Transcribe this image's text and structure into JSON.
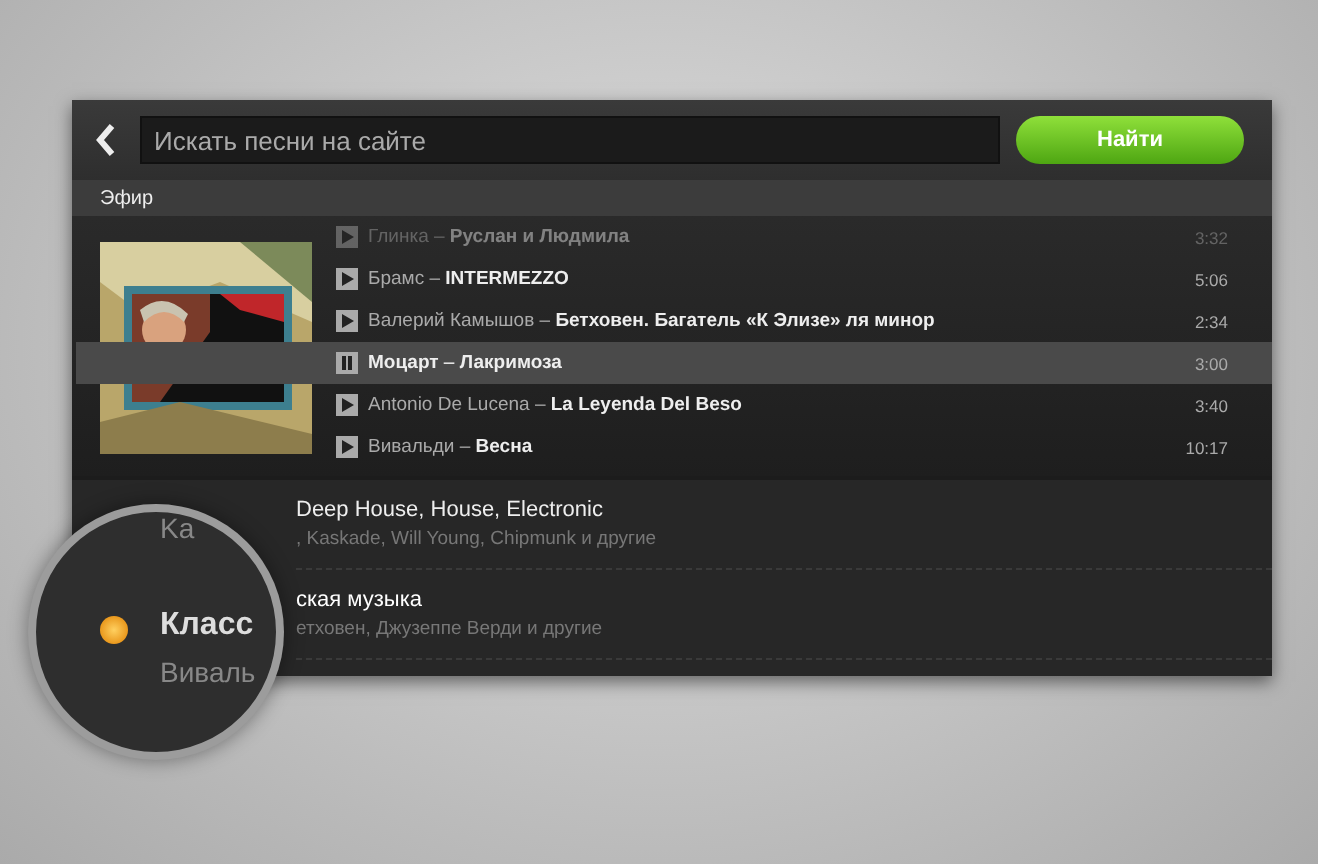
{
  "search": {
    "placeholder": "Искать песни на сайте",
    "button": "Найти"
  },
  "section": "Эфир",
  "tracks": [
    {
      "text": "Глинка – **Руслан и Людмила**",
      "time": "3:32",
      "playing": false,
      "faded": true
    },
    {
      "text": "Брамс – **INTERMEZZO**",
      "time": "5:06",
      "playing": false,
      "faded": false
    },
    {
      "text": "Валерий Камышов – **Бетховен. Багатель «К Элизе» ля минор**",
      "time": "2:34",
      "playing": false,
      "faded": false
    },
    {
      "text": "**Моцарт** – **Лакримоза**",
      "time": "3:00",
      "playing": true,
      "faded": false
    },
    {
      "text": "Antonio De Lucena – **La Leyenda Del Beso**",
      "time": "3:40",
      "playing": false,
      "faded": false
    },
    {
      "text": "Вивальди – **Весна**",
      "time": "10:17",
      "playing": false,
      "faded": false
    }
  ],
  "stations": [
    {
      "title": "Deep House, House, Electronic",
      "subtitle": ", Kaskade, Will Young, Chipmunk и другие",
      "selected": false
    },
    {
      "title": "ская музыка",
      "subtitle": "етховен, Джузеппе Верди и другие",
      "selected": true
    }
  ],
  "lens": {
    "lines": [
      {
        "text": "Ka",
        "kind": "sub"
      },
      {
        "text": "Класс",
        "kind": "title"
      },
      {
        "text": "Виваль",
        "kind": "sub"
      }
    ],
    "dot": true
  }
}
